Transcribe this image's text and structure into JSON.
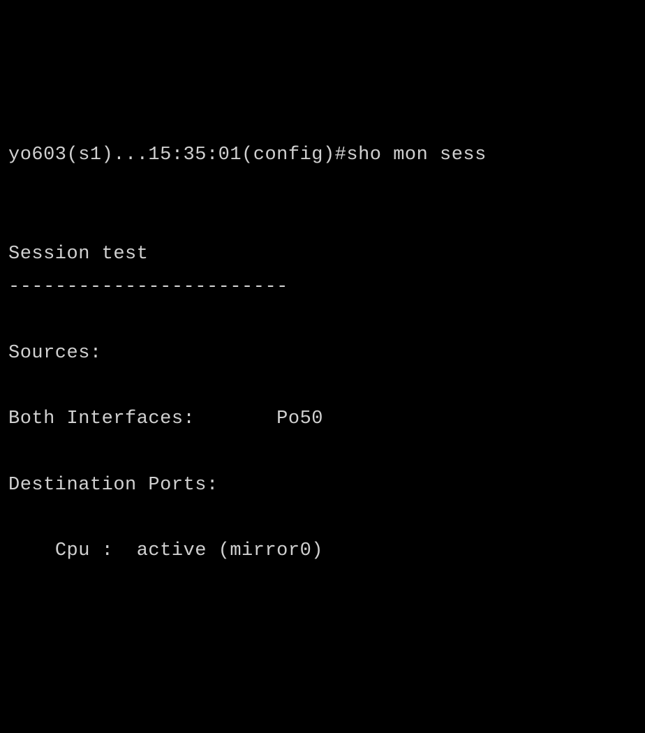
{
  "terminal": {
    "prompt": "yo603(s1)...15:35:01(config)#",
    "command": "sho mon sess",
    "session_header": "Session test",
    "separator": "------------------------",
    "sources_label": "Sources:",
    "both_interfaces_label": "Both Interfaces:",
    "both_interfaces_value": "Po50",
    "destination_ports_label": "Destination Ports:",
    "cpu_label": "Cpu :",
    "cpu_status": "active (mirror0)"
  }
}
